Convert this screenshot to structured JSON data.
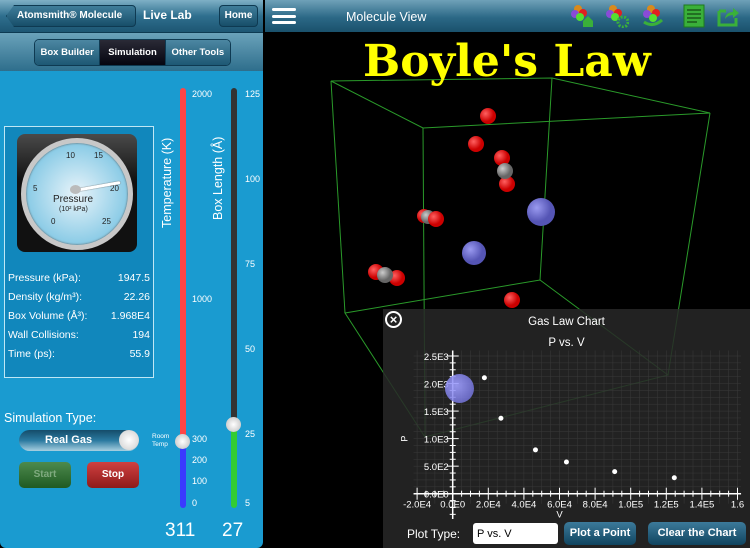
{
  "left": {
    "back_label": "Atomsmith® Molecule La...",
    "title": "Live Lab",
    "home_label": "Home",
    "segments": [
      "Box Builder",
      "Simulation",
      "Other Tools"
    ],
    "active_segment": "Simulation",
    "gauge": {
      "title": "Pressure",
      "unit": "(10² kPa)",
      "ticks": [
        "0",
        "5",
        "10",
        "15",
        "20",
        "25"
      ],
      "value": 19.475
    },
    "stats": [
      {
        "label": "Pressure (kPa):",
        "value": "1947.5"
      },
      {
        "label": "Density (kg/m³):",
        "value": "22.26"
      },
      {
        "label": "Box Volume (Å³):",
        "value": "1.968E4"
      },
      {
        "label": "Wall Collisions:",
        "value": "194"
      },
      {
        "label": "Time (ps):",
        "value": "55.9"
      }
    ],
    "simulation_type_label": "Simulation Type:",
    "simulation_type_value": "Real Gas",
    "start_label": "Start",
    "stop_label": "Stop",
    "temperature": {
      "label": "Temperature (K)",
      "ticks": [
        "2000",
        "1000",
        "300",
        "200",
        "100",
        "0"
      ],
      "room_temp_label": "Room Temp",
      "value": "311",
      "colors": {
        "hot": "#ff4040",
        "cold": "#3a3aff"
      }
    },
    "box_length": {
      "label": "Box Length (Å)",
      "ticks": [
        "125",
        "100",
        "75",
        "50",
        "25",
        "5"
      ],
      "value": "27",
      "colors": {
        "fill": "#33cc33",
        "empty": "#333333"
      }
    }
  },
  "right": {
    "title": "Molecule View",
    "heading": "Boyle's Law",
    "toolbar_icons": [
      "molecule-home-icon",
      "molecule-settings-icon",
      "molecule-refresh-icon",
      "notes-icon",
      "share-icon"
    ],
    "chart": {
      "panel_title": "Gas Law Chart",
      "plot_type_label": "Plot Type:",
      "plot_type_value": "P vs. V",
      "plot_point_label": "Plot a Point",
      "clear_label": "Clear the Chart"
    }
  },
  "chart_data": {
    "type": "scatter",
    "title": "P vs. V",
    "xlabel": "V",
    "ylabel": "P",
    "x_ticks": [
      "-2.0E4",
      "0.0E0",
      "2.0E4",
      "4.0E4",
      "6.0E4",
      "8.0E4",
      "1.0E5",
      "1.2E5",
      "1.4E5",
      "1.6"
    ],
    "y_ticks": [
      "0.0E0",
      "5.0E2",
      "1.0E3",
      "1.5E3",
      "2.0E3",
      "2.5E3"
    ],
    "xlim": [
      -20000,
      160000
    ],
    "ylim": [
      0,
      2500
    ],
    "grid": true,
    "x": [
      17800,
      27100,
      46500,
      63900,
      91000,
      124500
    ],
    "y": [
      2105,
      1370,
      795,
      575,
      400,
      290
    ]
  }
}
